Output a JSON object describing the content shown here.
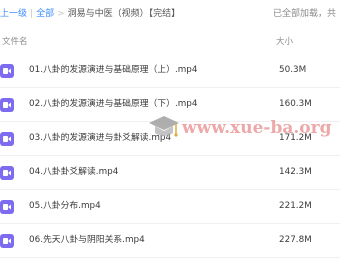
{
  "breadcrumb": {
    "up_label": "上一级",
    "sep1": "|",
    "all_label": "全部",
    "sep2": ">",
    "current_label": "洞易与中医（视频）【完结】",
    "status": "已全部加载，共"
  },
  "header": {
    "name_label": "文件名",
    "size_label": "大小"
  },
  "files": [
    {
      "name": "01.八卦的发源演进与基础原理（上）.mp4",
      "size": "50.3M"
    },
    {
      "name": "02.八卦的发源演进与基础原理（下）.mp4",
      "size": "160.3M"
    },
    {
      "name": "03.八卦的发源演进与卦爻解读.mp4",
      "size": "171.2M"
    },
    {
      "name": "04.八卦卦爻解读.mp4",
      "size": "142.3M"
    },
    {
      "name": "05.八卦分布.mp4",
      "size": "221.2M"
    },
    {
      "name": "06.先天八卦与阴阳关系.mp4",
      "size": "227.8M"
    }
  ],
  "watermark": {
    "text": "www.xue-ba.org"
  },
  "colors": {
    "accent": "#3b8cff",
    "file_icon": "#7d6cf0",
    "watermark": "#ea9a9a"
  },
  "icons": {
    "file_icon": "video-file-icon",
    "watermark_icon": "graduation-cap-icon"
  }
}
